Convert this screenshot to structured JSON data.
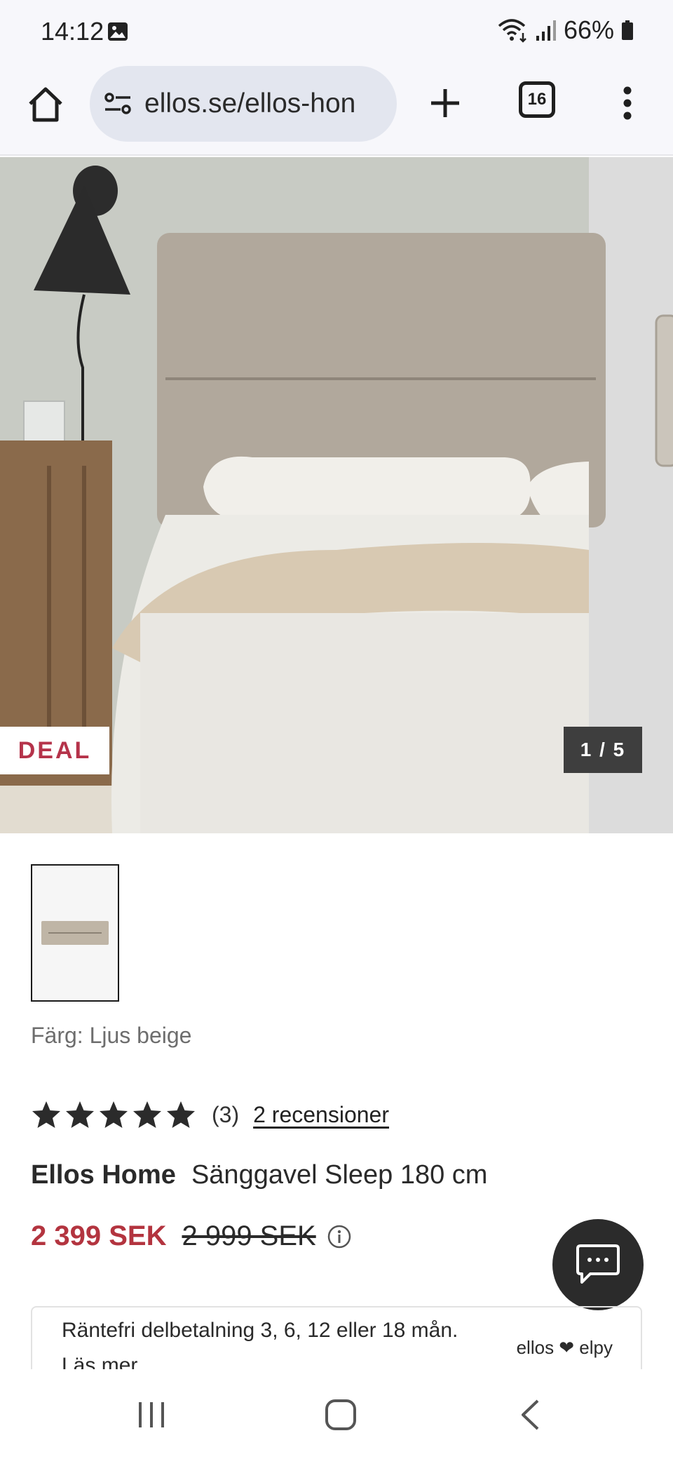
{
  "status_bar": {
    "time": "14:12",
    "battery": "66%",
    "icons": [
      "image-icon",
      "wifi-icon",
      "signal-icon",
      "battery-icon"
    ]
  },
  "browser": {
    "url": "ellos.se/ellos-hon",
    "tab_count": "16",
    "icons": [
      "home-icon",
      "site-settings-icon",
      "plus-icon",
      "tabs-icon",
      "more-vert-icon"
    ]
  },
  "gallery": {
    "badge": "DEAL",
    "counter": "1 / 5"
  },
  "product": {
    "color_label": "Färg: Ljus beige",
    "rating_stars": 5,
    "rating_count": "(3)",
    "reviews_link": "2 recensioner",
    "brand": "Ellos Home",
    "name": "Sänggavel Sleep 180 cm",
    "price_now": "2 399 SEK",
    "price_old": "2 999 SEK"
  },
  "payment": {
    "text": "Räntefri delbetalning 3, 6, 12 eller 18 mån.",
    "more": "Läs mer",
    "logo": "ellos ❤ elpy"
  },
  "colors": {
    "sale_red": "#b3343f",
    "deal_red": "#b5334a",
    "chat_bg": "#2b2b2b"
  }
}
